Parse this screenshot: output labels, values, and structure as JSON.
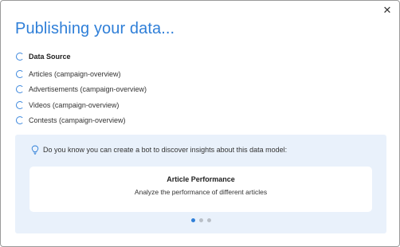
{
  "dialog": {
    "title": "Publishing your data...",
    "close_icon": "close-icon"
  },
  "steps": [
    {
      "label": "Data Source",
      "bold": true,
      "icon": "loading-spinner-icon"
    },
    {
      "label": "Articles (campaign-overview)",
      "bold": false,
      "icon": "loading-spinner-icon"
    },
    {
      "label": "Advertisements (campaign-overview)",
      "bold": false,
      "icon": "loading-spinner-icon"
    },
    {
      "label": "Videos (campaign-overview)",
      "bold": false,
      "icon": "loading-spinner-icon"
    },
    {
      "label": "Contests (campaign-overview)",
      "bold": false,
      "icon": "loading-spinner-icon"
    }
  ],
  "tip": {
    "icon": "lightbulb-icon",
    "text": "Do you know you can create a bot to discover insights about this data model:"
  },
  "carousel": {
    "card_title": "Article Performance",
    "card_subtitle": "Analyze the performance of different articles",
    "active_index": 0,
    "total": 3
  },
  "colors": {
    "accent": "#2f7fd8",
    "tip_background": "#e9f1fb",
    "dot_inactive": "#b9bfc7"
  }
}
